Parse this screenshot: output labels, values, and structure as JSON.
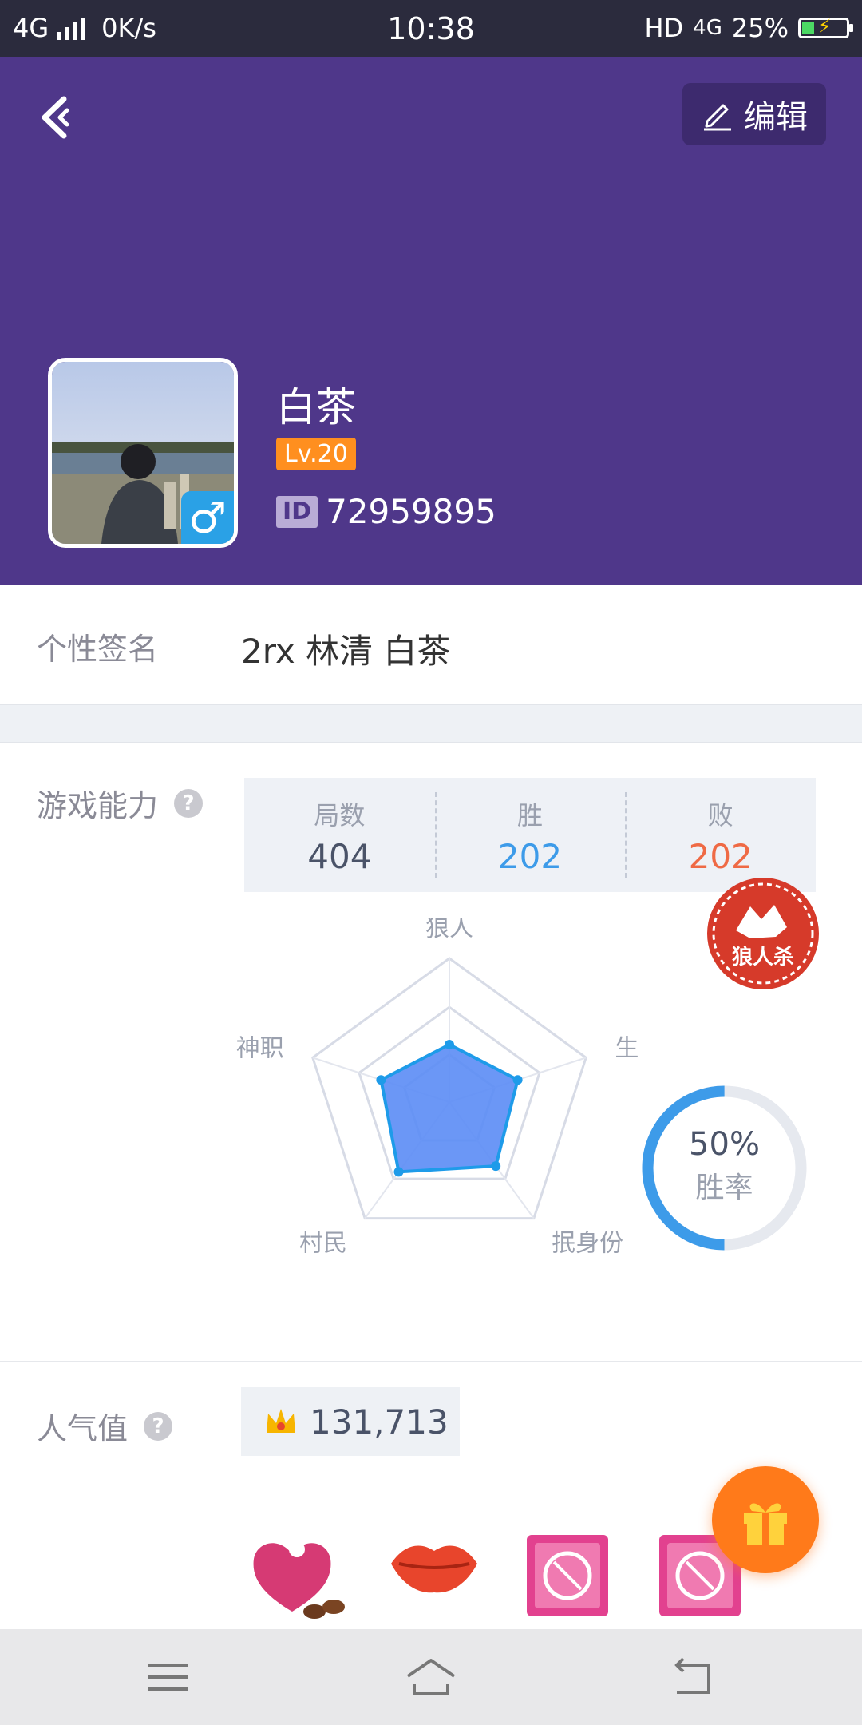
{
  "status_bar": {
    "network": "4G",
    "speed": "0K/s",
    "time": "10:38",
    "hd": "HD",
    "network_right": "4G",
    "battery": "25%",
    "battery_level": 0.25
  },
  "header": {
    "edit_label": "编辑",
    "name": "白茶",
    "level": "Lv.20",
    "id_tag": "ID",
    "id_value": "72959895",
    "accent": "#4f378a"
  },
  "signature": {
    "label": "个性签名",
    "value": "2rx 林清 白茶"
  },
  "game": {
    "label": "游戏能力",
    "help": "?",
    "stats": [
      {
        "label": "局数",
        "value": "404",
        "color": "#4a5368"
      },
      {
        "label": "胜",
        "value": "202",
        "color": "#3d9be9"
      },
      {
        "label": "败",
        "value": "202",
        "color": "#ef6a45"
      }
    ],
    "stamp_text": "狼人杀",
    "radar": {
      "axes": [
        "狼人",
        "生存",
        "抿身份",
        "村民",
        "神职"
      ],
      "values": [
        0.4,
        0.5,
        0.55,
        0.6,
        0.5
      ]
    },
    "win_rate": {
      "percent": "50%",
      "label": "胜率",
      "value": 0.5
    }
  },
  "popularity": {
    "label": "人气值",
    "help": "?",
    "value": "131,713"
  },
  "gifts": [
    "heart-box-gift-icon",
    "lips-gift-icon",
    "pink-package-gift-icon",
    "pink-package-gift-icon"
  ],
  "nav": [
    "menu-icon",
    "home-icon",
    "back-icon"
  ]
}
